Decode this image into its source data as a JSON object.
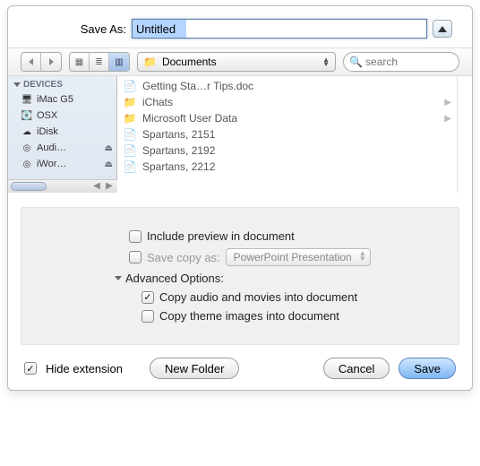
{
  "save_as": {
    "label": "Save As:",
    "filename": "Untitled"
  },
  "toolbar": {
    "location": "Documents",
    "search_placeholder": "search"
  },
  "sidebar": {
    "header": "DEVICES",
    "items": [
      {
        "label": "iMac G5",
        "icon": "imac"
      },
      {
        "label": "OSX",
        "icon": "hdd"
      },
      {
        "label": "iDisk",
        "icon": "idisk"
      },
      {
        "label": "Audi…",
        "icon": "disc",
        "ejectable": true
      },
      {
        "label": "iWor…",
        "icon": "disc",
        "ejectable": true
      }
    ]
  },
  "files": [
    {
      "name": "Getting Sta…r Tips.doc",
      "type": "doc"
    },
    {
      "name": "iChats",
      "type": "folder"
    },
    {
      "name": "Microsoft User Data",
      "type": "folder"
    },
    {
      "name": "Spartans, 2151",
      "type": "doc"
    },
    {
      "name": "Spartans, 2192",
      "type": "doc"
    },
    {
      "name": "Spartans, 2212",
      "type": "doc"
    }
  ],
  "options": {
    "include_preview": {
      "label": "Include preview in document",
      "checked": false
    },
    "save_copy": {
      "label": "Save copy as:",
      "checked": false,
      "format": "PowerPoint Presentation"
    },
    "advanced_label": "Advanced Options:",
    "copy_media": {
      "label": "Copy audio and movies into document",
      "checked": true
    },
    "copy_theme": {
      "label": "Copy theme images into document",
      "checked": false
    }
  },
  "bottom": {
    "hide_ext": {
      "label": "Hide extension",
      "checked": true
    },
    "new_folder": "New Folder",
    "cancel": "Cancel",
    "save": "Save"
  }
}
